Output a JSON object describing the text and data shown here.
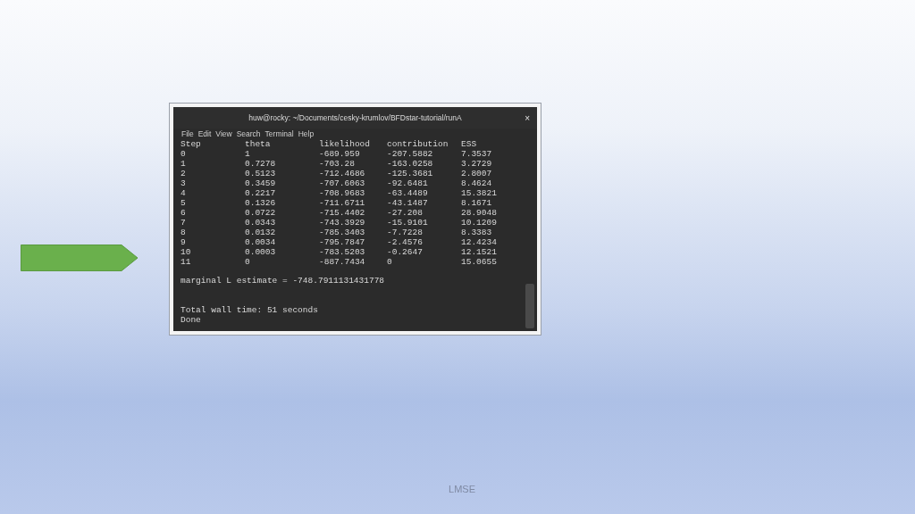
{
  "terminal": {
    "title": "huw@rocky: ~/Documents/cesky-krumlov/BFDstar-tutorial/runA",
    "close": "×",
    "menu": [
      "File",
      "Edit",
      "View",
      "Search",
      "Terminal",
      "Help"
    ],
    "columns": [
      "Step",
      "theta",
      "likelihood",
      "contribution",
      "ESS"
    ],
    "rows": [
      [
        "0",
        "1",
        "-689.959",
        "-207.5882",
        "7.3537"
      ],
      [
        "1",
        "0.7278",
        "-703.28",
        "-163.0258",
        "3.2729"
      ],
      [
        "2",
        "0.5123",
        "-712.4686",
        "-125.3681",
        "2.8007"
      ],
      [
        "3",
        "0.3459",
        "-707.6063",
        "-92.6481",
        "8.4624"
      ],
      [
        "4",
        "0.2217",
        "-708.9683",
        "-63.4489",
        "15.3821"
      ],
      [
        "5",
        "0.1326",
        "-711.6711",
        "-43.1487",
        "8.1671"
      ],
      [
        "6",
        "0.0722",
        "-715.4402",
        "-27.208",
        "28.9048"
      ],
      [
        "7",
        "0.0343",
        "-743.3929",
        "-15.9101",
        "10.1209"
      ],
      [
        "8",
        "0.0132",
        "-785.3403",
        "-7.7228",
        "8.3383"
      ],
      [
        "9",
        "0.0034",
        "-795.7847",
        "-2.4576",
        "12.4234"
      ],
      [
        "10",
        "0.0003",
        "-783.5203",
        "-0.2647",
        "12.1521"
      ],
      [
        "11",
        "0",
        "-887.7434",
        "0",
        "15.0655"
      ]
    ],
    "estimate": "marginal L estimate = -748.7911131431778",
    "wall_time": "Total wall time: 51 seconds",
    "done": "Done"
  },
  "footer": "LMSE"
}
